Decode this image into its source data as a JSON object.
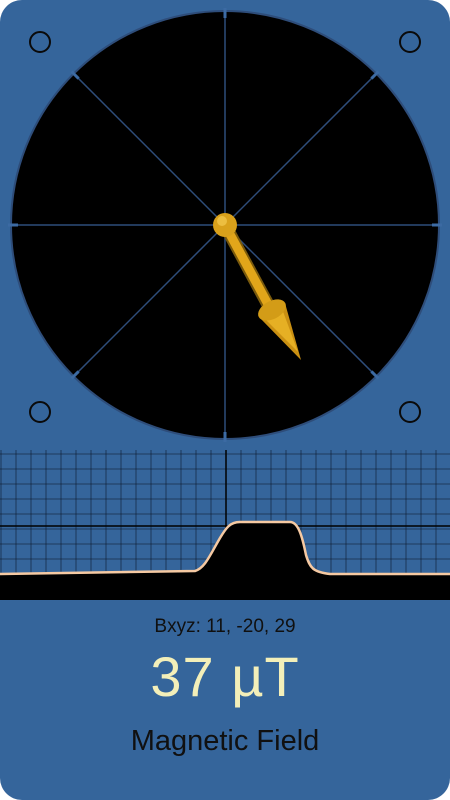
{
  "compass": {
    "needle_color": "#e2a61a",
    "ring_color": "#2e4d7a",
    "face_color": "#000000",
    "bezel_color": "#35659b"
  },
  "graph": {
    "grid_color": "#2c4f80",
    "background_color": "#35659b",
    "trace_color": "#f5c9a2"
  },
  "readout": {
    "bxyz_label": "Bxyz:",
    "bxyz_values": "11, -20, 29",
    "magnitude_value": "37",
    "magnitude_unit": "µT",
    "title": "Magnetic Field",
    "value_color": "#f3efb9"
  }
}
